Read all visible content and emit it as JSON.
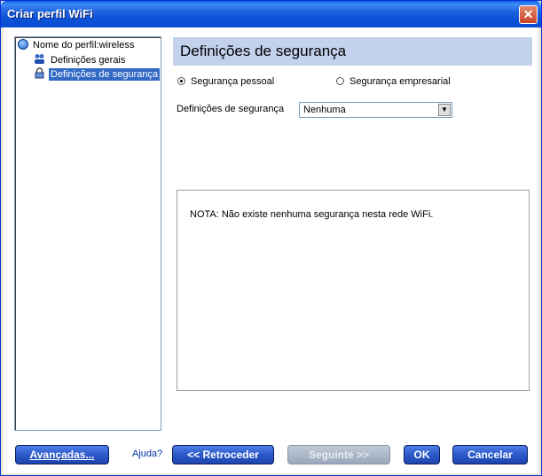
{
  "window": {
    "title": "Criar perfil WiFi"
  },
  "tree": {
    "root": "Nome do perfil:wireless",
    "items": [
      {
        "label": "Definições gerais"
      },
      {
        "label": "Definições de segurança"
      }
    ]
  },
  "header": {
    "title": "Definições de segurança"
  },
  "security": {
    "personal_label": "Segurança pessoal",
    "enterprise_label": "Segurança empresarial",
    "field_label": "Definições de segurança",
    "selected": "Nenhuma"
  },
  "note": "NOTA: Não existe nenhuma segurança nesta rede WiFi.",
  "buttons": {
    "advanced": "Avançadas...",
    "help": "Ajuda?",
    "back": "<< Retroceder",
    "next": "Seguinte >>",
    "ok": "OK",
    "cancel": "Cancelar"
  }
}
